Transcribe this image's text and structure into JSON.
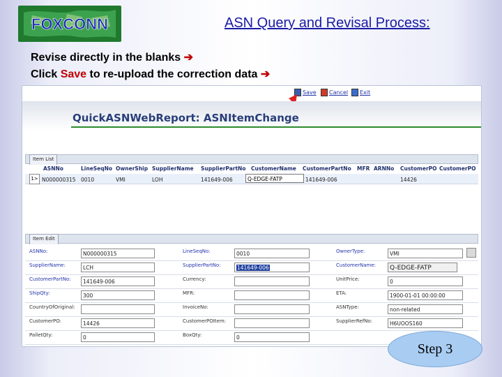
{
  "slide": {
    "logo_text": "FOXCONN",
    "title": "ASN Query and Revisal Process:",
    "instruction_1": "Revise directly in the blanks ",
    "instruction_2_prefix": "Click ",
    "instruction_2_save": "Save",
    "instruction_2_suffix": " to re-upload the correction data ",
    "arrow": "➔",
    "step_label": "Step 3"
  },
  "toolbar": {
    "save_label": "Save",
    "cancel_label": "Cancel",
    "exit_label": "Exit"
  },
  "page": {
    "title": "QuickASNWebReport: ASNItemChange"
  },
  "item_list": {
    "tab_label": "Item List",
    "columns": [
      "ASNNo",
      "LineSeqNo",
      "OwnerShip",
      "SupplierName",
      "SupplierPartNo",
      "CustomerName",
      "CustomerPartNo",
      "MFR",
      "ARNNo",
      "CustomerPO",
      "CustomerPO"
    ],
    "row": {
      "selector": "1>",
      "asnno": "N000000315",
      "line_seq": "0010",
      "ownership": "VMI",
      "supplier_name": "LOH",
      "supplier_part": "141649-006",
      "customer_name": "Q-EDGE-FATP",
      "customer_part": "141649-006",
      "customer_po": "14426"
    }
  },
  "item_edit": {
    "tab_label": "Item Edit",
    "rows": [
      [
        {
          "label": "ASNNo:",
          "value": ""
        },
        {
          "label": "LineSeqNo:",
          "value": "0010"
        },
        {
          "label": "OwnerType:",
          "value": "VMI"
        }
      ],
      [
        {
          "label": "SupplierName:",
          "value": "LCH"
        },
        {
          "label": "SupplierPartNo:",
          "value": "141649-006"
        },
        {
          "label": "CustomerName:",
          "value": "Q-EDGE-FATP"
        }
      ],
      [
        {
          "label": "CustomerPartNo:",
          "value": "141649-006"
        },
        {
          "label": "Currency:",
          "value": ""
        },
        {
          "label": "UnitPrice:",
          "value": "0"
        }
      ],
      [
        {
          "label": "ShipQty:",
          "value": "300"
        },
        {
          "label": "MFR:",
          "value": ""
        },
        {
          "label": "ETA:",
          "value": "1900-01-01 00:00:00"
        }
      ],
      [
        {
          "label": "CountryOfOriginal:",
          "value": ""
        },
        {
          "label": "InvoiceNo:",
          "value": ""
        },
        {
          "label": "ASNType:",
          "value": "non-related"
        }
      ],
      [
        {
          "label": "CustomerPO:",
          "value": "14426"
        },
        {
          "label": "CustomerPOItem:",
          "value": ""
        },
        {
          "label": "SupplierRefNo:",
          "value": "H6UOOS160"
        }
      ],
      [
        {
          "label": "PalletQty:",
          "value": "0"
        },
        {
          "label": "BoxQty:",
          "value": "0"
        }
      ]
    ],
    "asnno_value": "N000000315"
  },
  "colors": {
    "title_blue": "#1a1aa6",
    "accent_red": "#c00000",
    "header_blue": "#2a3f7a",
    "step_fill": "#a9cdf2"
  }
}
